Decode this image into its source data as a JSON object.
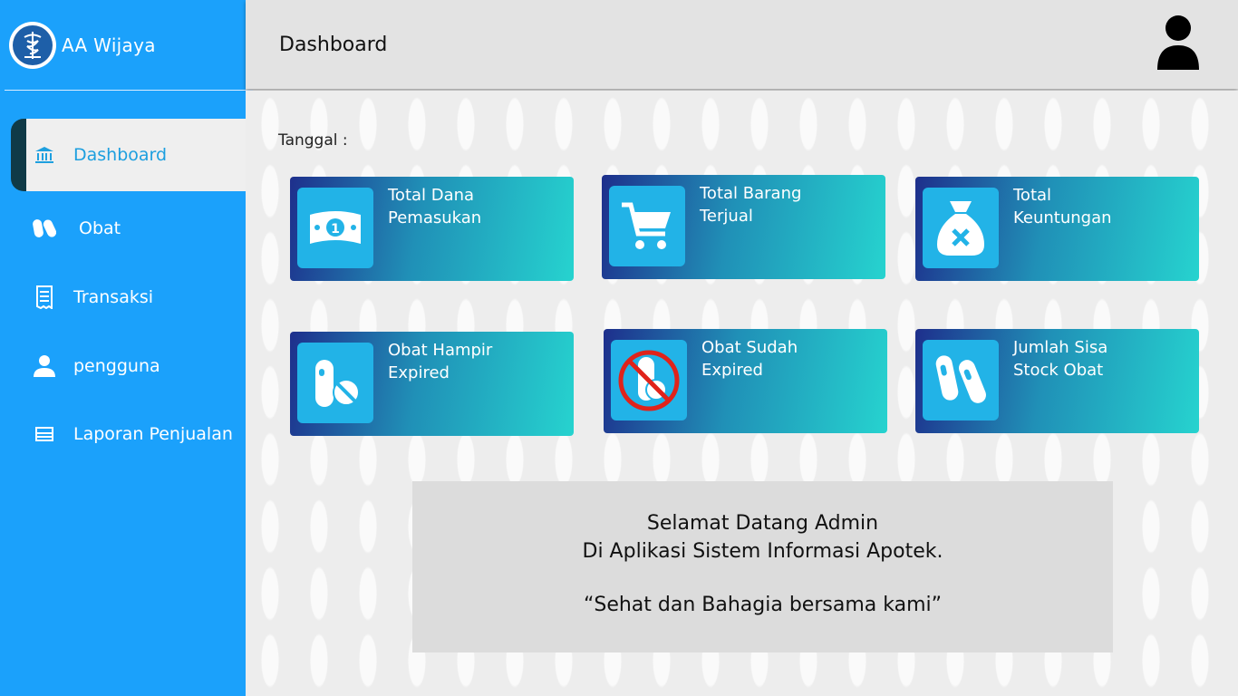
{
  "brand": {
    "name": "AA Wijaya",
    "logo_icon": "pharmacy-caduceus-icon"
  },
  "sidebar": {
    "items": [
      {
        "label": "Dashboard",
        "icon": "bank-icon",
        "active": true
      },
      {
        "label": "Obat",
        "icon": "pills-icon",
        "active": false
      },
      {
        "label": "Transaksi",
        "icon": "receipt-icon",
        "active": false
      },
      {
        "label": "pengguna",
        "icon": "user-icon",
        "active": false
      },
      {
        "label": "Laporan Penjualan",
        "icon": "report-icon",
        "active": false
      }
    ]
  },
  "header": {
    "title": "Dashboard",
    "avatar_icon": "user-avatar-icon"
  },
  "main": {
    "date_label": "Tanggal :",
    "cards": [
      {
        "label": "Total Dana\nPemasukan",
        "icon": "money-icon"
      },
      {
        "label": "Total Barang\nTerjual",
        "icon": "cart-icon"
      },
      {
        "label": "Total\nKeuntungan",
        "icon": "money-bag-icon"
      },
      {
        "label": "Obat Hampir\nExpired",
        "icon": "pill-warning-icon"
      },
      {
        "label": "Obat Sudah\n Expired",
        "icon": "pill-forbidden-icon"
      },
      {
        "label": "Jumlah Sisa\nStock Obat",
        "icon": "capsules-icon"
      }
    ],
    "welcome": {
      "line1": "Selamat Datang Admin",
      "line2": "Di Aplikasi Sistem Informasi Apotek.",
      "line3": "“Sehat dan Bahagia bersama kami”"
    }
  },
  "colors": {
    "sidebar": "#1ba1fb",
    "active_text": "#1d9fdf",
    "card_start": "#1e2f8c",
    "card_end": "#26d3cf",
    "icon_tile": "#22b3e7"
  }
}
